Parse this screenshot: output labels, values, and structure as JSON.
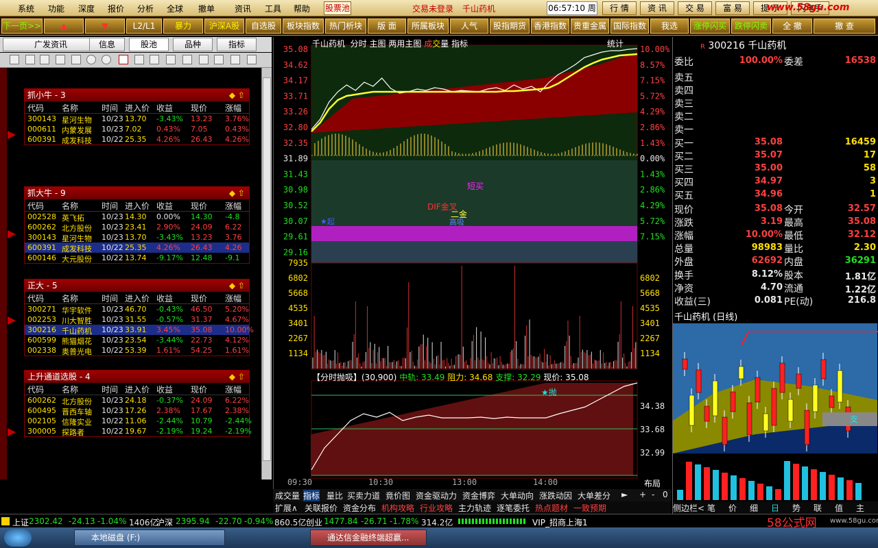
{
  "menu": {
    "items": [
      "系统",
      "功能",
      "深度",
      "报价",
      "分析",
      "全球",
      "撤单",
      "资讯",
      "工具",
      "帮助"
    ],
    "pool": "股票池",
    "status": "交易未登录",
    "stock": "千山药机",
    "clock": "06:57:10",
    "weekday": "周五",
    "right_buttons": [
      "行 情",
      "资 讯",
      "交 易",
      "富 易",
      "提 示",
      "闪电手"
    ],
    "watermark": "www.58gu.com"
  },
  "toolbar": {
    "items": [
      {
        "label": "下一页>>",
        "c": "g"
      },
      {
        "label": "▲",
        "c": "r"
      },
      {
        "label": "▼",
        "c": "r"
      },
      {
        "label": "L2/L1",
        "c": "w"
      },
      {
        "label": "暴力",
        "c": "y"
      },
      {
        "label": "沪深A股",
        "c": "w"
      },
      {
        "label": "自选股",
        "c": "w"
      },
      {
        "label": "板块指数",
        "c": "w"
      },
      {
        "label": "热门析块",
        "c": "w"
      },
      {
        "label": "版 面",
        "c": "w"
      },
      {
        "label": "所属板块",
        "c": "w"
      },
      {
        "label": "人气",
        "c": "w"
      },
      {
        "label": "股指期货",
        "c": "w"
      },
      {
        "label": "香港指数",
        "c": "w"
      },
      {
        "label": "贵重金属",
        "c": "w"
      },
      {
        "label": "国际指数",
        "c": "w"
      },
      {
        "label": "我选",
        "c": "w"
      },
      {
        "label": "涨停闪买",
        "c": "g"
      },
      {
        "label": "跌停闪卖",
        "c": "g"
      },
      {
        "label": "全 撤",
        "c": "w"
      },
      {
        "label": "撤 查",
        "c": "w"
      }
    ]
  },
  "left": {
    "tabs": [
      "广发资讯",
      "信息",
      "股池",
      "品种",
      "指标"
    ],
    "columns": [
      "代码",
      "名称",
      "时间",
      "进入价",
      "收益",
      "现价",
      "涨幅"
    ],
    "pools": [
      {
        "title": "抓小牛 - 3",
        "rows": [
          [
            "300143",
            "星河生物",
            "10/23",
            "13.70",
            "-3.43%",
            "13.23",
            "3.76%"
          ],
          [
            "000611",
            "内蒙发展",
            "10/23",
            "7.02",
            "0.43%",
            "7.05",
            "0.43%"
          ],
          [
            "600391",
            "成发科技",
            "10/22",
            "25.35",
            "4.26%",
            "26.43",
            "4.26%"
          ]
        ]
      },
      {
        "title": "抓大牛 - 9",
        "rows": [
          [
            "002528",
            "英飞拓",
            "10/23",
            "14.30",
            "0.00%",
            "14.30",
            "-4.8"
          ],
          [
            "600262",
            "北方股份",
            "10/23",
            "23.41",
            "2.90%",
            "24.09",
            "6.22"
          ],
          [
            "300143",
            "星河生物",
            "10/23",
            "13.70",
            "-3.43%",
            "13.23",
            "3.76"
          ],
          [
            "600391",
            "成发科技",
            "10/22",
            "25.35",
            "4.26%",
            "26.43",
            "4.26"
          ],
          [
            "600146",
            "大元股份",
            "10/22",
            "13.74",
            "-9.17%",
            "12.48",
            "-9.1"
          ]
        ],
        "selected": 3
      },
      {
        "title": "正大 - 5",
        "rows": [
          [
            "300271",
            "华宇软件",
            "10/23",
            "46.70",
            "-0.43%",
            "46.50",
            "5.20%"
          ],
          [
            "002253",
            "川大智胜",
            "10/23",
            "31.55",
            "-0.57%",
            "31.37",
            "4.67%"
          ],
          [
            "300216",
            "千山药机",
            "10/23",
            "33.91",
            "3.45%",
            "35.08",
            "10.00%"
          ],
          [
            "600599",
            "熊猫烟花",
            "10/23",
            "23.54",
            "-3.44%",
            "22.73",
            "4.12%"
          ],
          [
            "002338",
            "奥普光电",
            "10/22",
            "53.39",
            "1.61%",
            "54.25",
            "1.61%"
          ]
        ],
        "selected": 2
      },
      {
        "title": "上升通道选股 - 4",
        "rows": [
          [
            "600262",
            "北方股份",
            "10/23",
            "24.18",
            "-0.37%",
            "24.09",
            "6.22%"
          ],
          [
            "600495",
            "晋西车轴",
            "10/23",
            "17.26",
            "2.38%",
            "17.67",
            "2.38%"
          ],
          [
            "002105",
            "信隆实业",
            "10/22",
            "11.06",
            "-2.44%",
            "10.79",
            "-2.44%"
          ],
          [
            "300005",
            "探路者",
            "10/22",
            "19.67",
            "-2.19%",
            "19.24",
            "-2.19%"
          ]
        ]
      }
    ]
  },
  "center": {
    "header": {
      "name": "千山药机",
      "items": [
        "分时",
        "主图",
        "两用主图"
      ],
      "cj": "成",
      "jiao": "交",
      "liang": "量",
      "zb": "指标",
      "tongji": "统计"
    },
    "price_axis": [
      "35.08",
      "34.62",
      "34.17",
      "33.71",
      "33.26",
      "32.80",
      "32.35",
      "31.89",
      "31.43",
      "30.98",
      "30.52",
      "30.07",
      "29.61",
      "29.16"
    ],
    "pct_axis_up": [
      "10.00%",
      "8.57%",
      "7.15%",
      "5.72%",
      "4.29%",
      "2.86%",
      "1.43%",
      "0.00%"
    ],
    "pct_axis_dn": [
      "1.43%",
      "2.86%",
      "4.29%",
      "5.72%",
      "7.15%"
    ],
    "vol_axis": [
      "7935",
      "6802",
      "5668",
      "4535",
      "3401",
      "2267",
      "1134"
    ],
    "annotations": {
      "duanmai": "短买",
      "dif": "DIF金叉",
      "ejin": "二金",
      "qi": "★起",
      "gao": "高吸"
    },
    "sub": {
      "title": "【分时抛吸】(30,900)",
      "zg": "中轨: 33.49",
      "zl": "阻力: 34.68",
      "zc": "支撑: 32.29",
      "xj": "现价: 35.08",
      "pao": "★抛"
    },
    "sub_axis": [
      "34.38",
      "33.68",
      "32.99"
    ],
    "time_axis": [
      "09:30",
      "10:30",
      "13:00",
      "14:00"
    ],
    "buju": "布局",
    "tabs1": [
      "成交量",
      "指标",
      "量比",
      "买卖力道",
      "竟价图",
      "资金驱动力",
      "资金博弈",
      "大单动向",
      "涨跌动因",
      "大单差分"
    ],
    "tabs2": [
      "扩展∧",
      "关联报价",
      "资金分布",
      "机构攻略",
      "行业攻略",
      "主力轨迹",
      "逐笔委托",
      "热点题材",
      "一致预期"
    ],
    "ctrl": [
      "►",
      "+",
      "-",
      "0"
    ]
  },
  "right": {
    "code": "300216",
    "name": "千山药机",
    "weibi_label": "委比",
    "weibi": "100.00%",
    "weicha_label": "委差",
    "weicha": "16538",
    "sells": [
      "卖五",
      "卖四",
      "卖三",
      "卖二",
      "卖一"
    ],
    "buys": [
      [
        "买一",
        "35.08",
        "16459"
      ],
      [
        "买二",
        "35.07",
        "17"
      ],
      [
        "买三",
        "35.00",
        "58"
      ],
      [
        "买四",
        "34.97",
        "3"
      ],
      [
        "买五",
        "34.96",
        "1"
      ]
    ],
    "stats": [
      [
        "现价",
        "35.08",
        "今开",
        "32.57"
      ],
      [
        "涨跌",
        "3.19",
        "最高",
        "35.08"
      ],
      [
        "涨幅",
        "10.00%",
        "最低",
        "32.12"
      ],
      [
        "总量",
        "98983",
        "量比",
        "2.30"
      ],
      [
        "外盘",
        "62692",
        "内盘",
        "36291"
      ]
    ],
    "stats2": [
      [
        "换手",
        "8.12%",
        "股本",
        "1.81亿"
      ],
      [
        "净资",
        "4.70",
        "流通",
        "1.22亿"
      ],
      [
        "收益(三)",
        "0.081",
        "PE(动)",
        "216.8"
      ]
    ],
    "kline_title": "千山药机 (日线)",
    "zhi": "支",
    "bottom_tabs": [
      "侧边栏<",
      "笔",
      "价",
      "细",
      "日",
      "势",
      "联",
      "值",
      "主"
    ]
  },
  "statusbar": {
    "sh_label": "上证",
    "sh": "2302.42",
    "sh_chg": "-24.13",
    "sh_pct": "-1.04%",
    "sh_amt": "1406亿",
    "hs_label": "沪深",
    "hs": "2395.94",
    "hs_chg": "-22.70",
    "hs_pct": "-0.94%",
    "hs_amt": "860.5亿",
    "cy_label": "创业",
    "cy": "1477.84",
    "cy_chg": "-26.71",
    "cy_pct": "-1.78%",
    "cy_amt": "314.2亿",
    "vip": "VIP_招商上海1",
    "logo": "58公式网",
    "logo_url": "www.58gu.com"
  },
  "taskbar": {
    "items": [
      "本地磁盘 (F:)",
      "通达信金融终端超赢..."
    ]
  }
}
